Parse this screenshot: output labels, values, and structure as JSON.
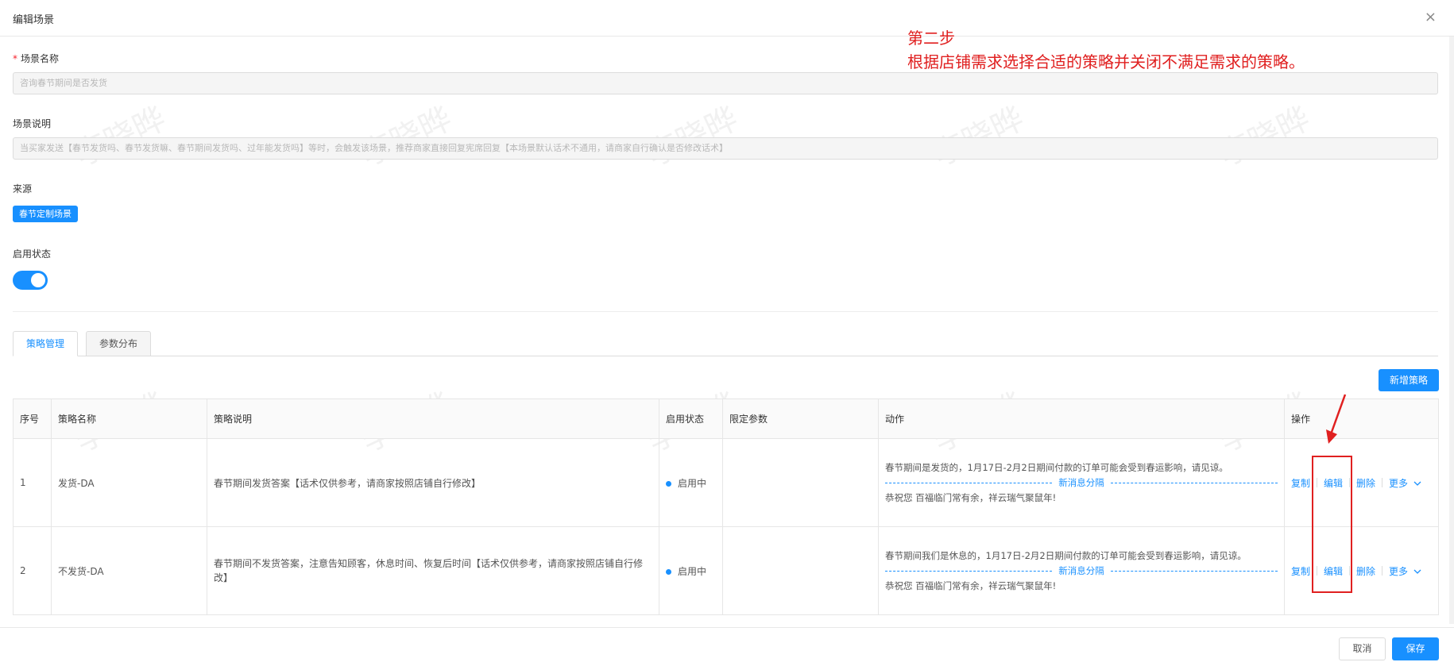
{
  "dialog": {
    "title": "编辑场景",
    "close_glyph": "×"
  },
  "form": {
    "name_label": "场景名称",
    "required_mark": "*",
    "name_value": "咨询春节期间是否发货",
    "desc_label": "场景说明",
    "desc_value": "当买家发送【春节发货吗、春节发货嘛、春节期间发货吗、过年能发货吗】等时，会触发该场景，推荐商家直接回复宪席回复【本场景默认话术不通用，请商家自行确认是否修改话术】",
    "source_label": "来源",
    "source_tag": "春节定制场景",
    "status_label": "启用状态",
    "status_enabled": true
  },
  "tabs": [
    {
      "label": "策略管理",
      "active": true
    },
    {
      "label": "参数分布",
      "active": false
    }
  ],
  "add_button": "新增策略",
  "table": {
    "columns": [
      "序号",
      "策略名称",
      "策略说明",
      "启用状态",
      "限定参数",
      "动作",
      "操作"
    ],
    "rows": [
      {
        "index": "1",
        "name": "发货-DA",
        "desc": "春节期间发货答案【话术仅供参考，请商家按照店铺自行修改】",
        "status": "启用中",
        "limit": "",
        "action_line1": "春节期间是发货的，1月17日-2月2日期间付款的订单可能会受到春运影响，请见谅。",
        "separator": "新消息分隔",
        "action_line2": "恭祝您 百福临门常有余，祥云瑞气聚鼠年!"
      },
      {
        "index": "2",
        "name": "不发货-DA",
        "desc": "春节期间不发货答案，注意告知顾客，休息时间、恢复后时间【话术仅供参考，请商家按照店铺自行修改】",
        "status": "启用中",
        "limit": "",
        "action_line1": "春节期间我们是休息的，1月17日-2月2日期间付款的订单可能会受到春运影响，请见谅。",
        "separator": "新消息分隔",
        "action_line2": "恭祝您 百福临门常有余，祥云瑞气聚鼠年!"
      }
    ],
    "ops": {
      "copy": "复制",
      "edit": "编辑",
      "delete": "删除",
      "more": "更多",
      "more_icon": "chevron-down-icon"
    }
  },
  "footer": {
    "cancel": "取消",
    "save": "保存"
  },
  "annotation": {
    "step": "第二步",
    "instruction": "根据店铺需求选择合适的策略并关闭不满足需求的策略。"
  },
  "watermark": "李晓晔",
  "colors": {
    "primary": "#1890ff",
    "annotation_red": "#e02020",
    "border": "#e6e6e6"
  }
}
